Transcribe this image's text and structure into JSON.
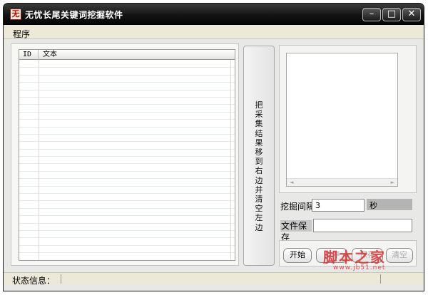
{
  "window": {
    "title": "无忧长尾关键词挖掘软件",
    "icon_glyph": "无",
    "controls": {
      "minimize": "–",
      "maximize": "□",
      "close": "✕"
    }
  },
  "menu": {
    "items": [
      {
        "label": "程序"
      }
    ]
  },
  "table": {
    "columns": [
      {
        "label": "ID"
      },
      {
        "label": "文本"
      }
    ],
    "rows": []
  },
  "move_button": {
    "label": "把采集结果移到右边并清空左边"
  },
  "right_panel": {
    "textarea_value": "",
    "scroll": {
      "left": "◄",
      "right": "►"
    }
  },
  "interval": {
    "label": "挖掘间隔",
    "value": "3",
    "unit": "秒"
  },
  "file_save": {
    "label": "文件保存",
    "value": ""
  },
  "buttons": {
    "start": "开始",
    "pause": "暂停",
    "save": "保存",
    "clear": "清空"
  },
  "status": {
    "label": "状态信息："
  },
  "watermark": {
    "text": "脚本之家",
    "url": "www.jb51.net"
  }
}
